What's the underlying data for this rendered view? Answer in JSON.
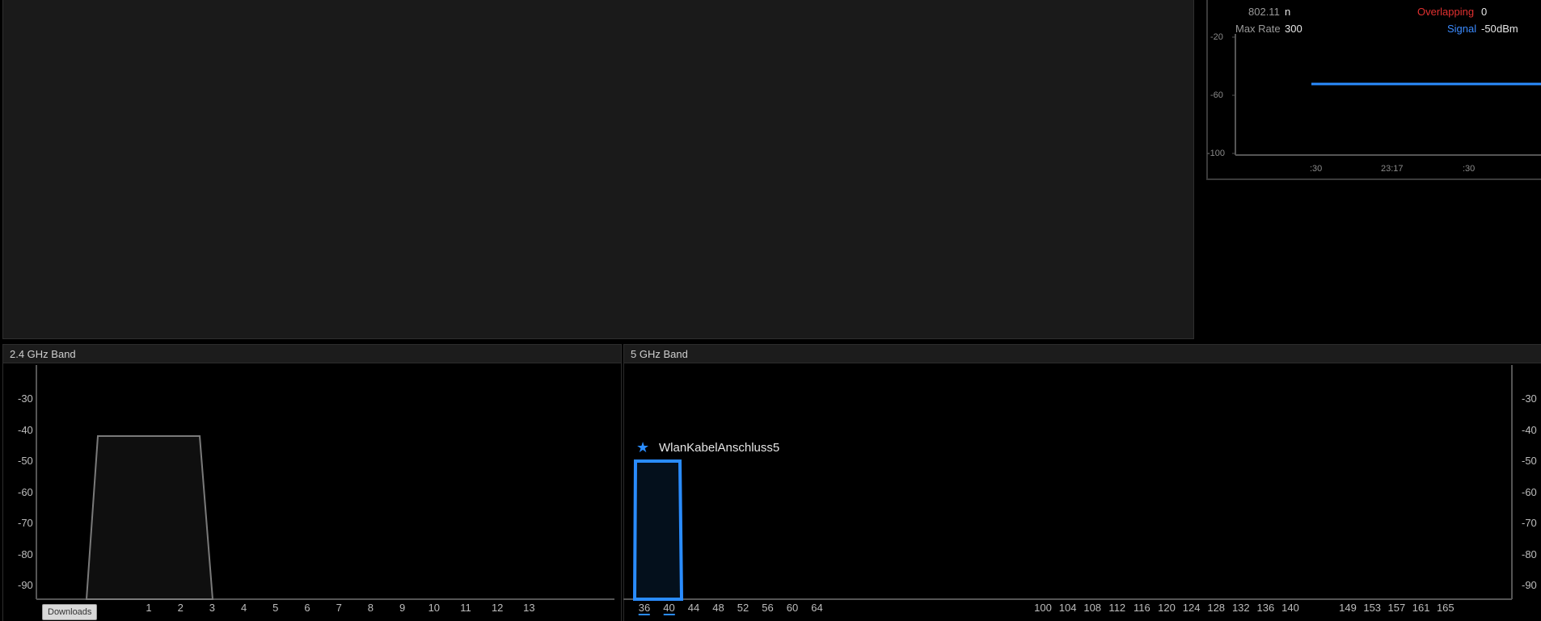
{
  "details": {
    "protocol_label": "802.11",
    "protocol_value": "n",
    "max_rate_label": "Max Rate",
    "max_rate_value": "300",
    "overlapping_label": "Overlapping",
    "overlapping_value": "0",
    "signal_label": "Signal",
    "signal_value": "-50",
    "signal_unit": "dBm",
    "colors": {
      "overlapping": "#e03030",
      "signal": "#3b8bff"
    }
  },
  "signal_chart": {
    "y_ticks": [
      "-20",
      "-60",
      "-100"
    ],
    "x_ticks": [
      ":30",
      "23:17",
      ":30"
    ]
  },
  "band24": {
    "title": "2.4 GHz Band",
    "y_ticks": [
      "-30",
      "-40",
      "-50",
      "-60",
      "-70",
      "-80",
      "-90"
    ],
    "x_ticks": [
      "1",
      "2",
      "3",
      "4",
      "5",
      "6",
      "7",
      "8",
      "9",
      "10",
      "11",
      "12",
      "13"
    ]
  },
  "band5": {
    "title": "5 GHz Band",
    "y_ticks": [
      "-30",
      "-40",
      "-50",
      "-60",
      "-70",
      "-80",
      "-90"
    ],
    "x_ticks_low": [
      "36",
      "40",
      "44",
      "48",
      "52",
      "56",
      "60",
      "64"
    ],
    "x_ticks_mid": [
      "100",
      "104",
      "108",
      "112",
      "116",
      "120",
      "124",
      "128",
      "132",
      "136",
      "140"
    ],
    "x_ticks_high": [
      "149",
      "153",
      "157",
      "161",
      "165"
    ],
    "network_name": "WlanKabelAnschluss5",
    "network_icon": "star-icon",
    "network_color": "#2a8cff"
  },
  "taskbar": {
    "downloads_label": "Downloads"
  },
  "chart_data": [
    {
      "type": "line",
      "title": "",
      "xlabel": "",
      "ylabel": "",
      "ylim": [
        -100,
        -20
      ],
      "x_ticks": [
        ":30",
        "23:17",
        ":30"
      ],
      "series": [
        {
          "values": [
            -50,
            -50
          ]
        }
      ]
    },
    {
      "type": "area",
      "title": "2.4 GHz Band",
      "ylim": [
        -95,
        -25
      ],
      "x": [
        "1",
        "2",
        "3",
        "4",
        "5",
        "6",
        "7",
        "8",
        "9",
        "10",
        "11",
        "12",
        "13"
      ],
      "series": [
        {
          "channel_span": [
            -1,
            3
          ],
          "signal": -42
        }
      ]
    },
    {
      "type": "area",
      "title": "5 GHz Band",
      "ylim": [
        -95,
        -25
      ],
      "series": [
        {
          "name": "WlanKabelAnschluss5",
          "channel_span": [
            34,
            42
          ],
          "signal": -50
        }
      ]
    }
  ]
}
